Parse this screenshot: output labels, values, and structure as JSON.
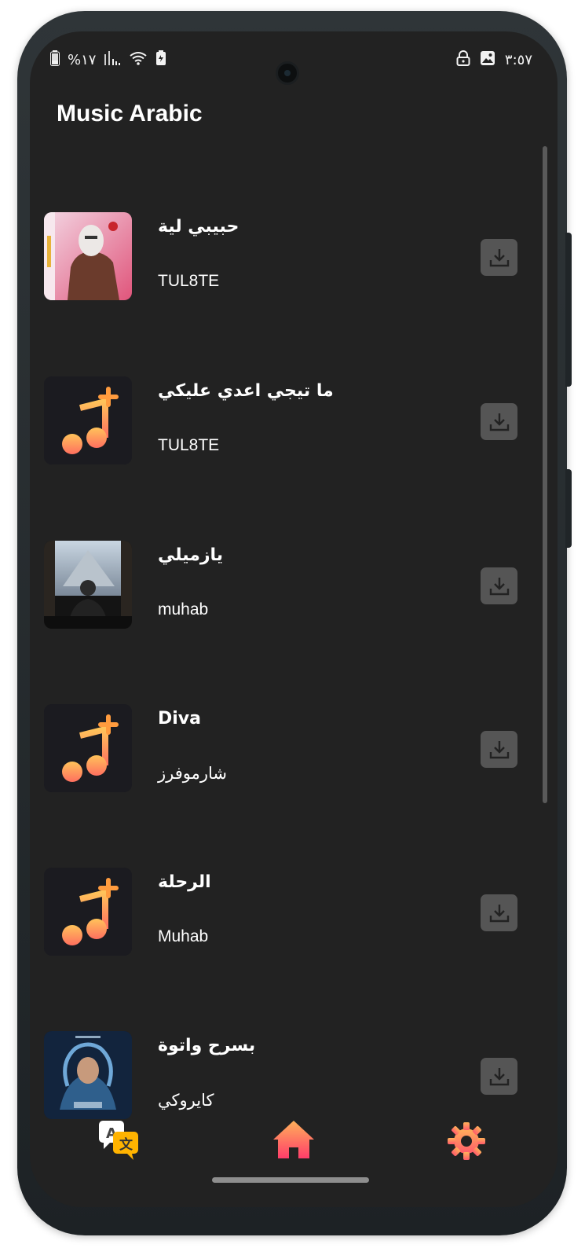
{
  "status_bar": {
    "battery_percent": "%١٧",
    "time": "٣:٥٧"
  },
  "app": {
    "title": "Music Arabic"
  },
  "songs": [
    {
      "title": "حبيبي لية",
      "artist": "TUL8TE",
      "thumbnail": "album-photo-red",
      "download_icon": "download-icon"
    },
    {
      "title": "ما تيجي اعدي عليكي",
      "artist": "TUL8TE",
      "thumbnail": "music-note-plus-placeholder",
      "download_icon": "download-icon"
    },
    {
      "title": "يازميلي",
      "artist": "muhab",
      "thumbnail": "album-photo-pyramid",
      "download_icon": "download-icon"
    },
    {
      "title": "Diva",
      "artist": "شارموفرز",
      "thumbnail": "music-note-plus-placeholder",
      "download_icon": "download-icon"
    },
    {
      "title": "الرحلة",
      "artist": "Muhab",
      "thumbnail": "music-note-plus-placeholder",
      "download_icon": "download-icon"
    },
    {
      "title": "بسرح واتوة",
      "artist": "كايروكي",
      "thumbnail": "album-photo-blue",
      "download_icon": "download-icon"
    }
  ],
  "bottom_nav": {
    "items": [
      "translate-icon",
      "home-icon",
      "settings-icon"
    ]
  },
  "colors": {
    "background": "#222222",
    "download_button": "#555555",
    "accent_gradient_start": "#FFB15A",
    "accent_gradient_end": "#FF4D6A",
    "placeholder_bg": "#1B1B20"
  }
}
